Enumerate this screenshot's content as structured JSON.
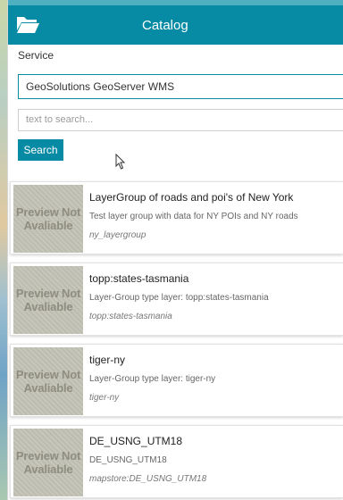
{
  "header": {
    "title": "Catalog",
    "icon": "folder-open-icon",
    "background_color": "#078aa3"
  },
  "service": {
    "label": "Service",
    "selected": "GeoSolutions GeoServer WMS"
  },
  "search": {
    "placeholder": "text to search...",
    "button_label": "Search"
  },
  "results": [
    {
      "thumbnail_text": "Preview Not Avaliable",
      "title": "LayerGroup of roads and poi's of New York",
      "description": "Test layer group with data for NY POIs and NY roads",
      "name": "ny_layergroup"
    },
    {
      "thumbnail_text": "Preview Not Avaliable",
      "title": "topp:states-tasmania",
      "description": "Layer-Group type layer: topp:states-tasmania",
      "name": "topp:states-tasmania"
    },
    {
      "thumbnail_text": "Preview Not Avaliable",
      "title": "tiger-ny",
      "description": "Layer-Group type layer: tiger-ny",
      "name": "tiger-ny"
    },
    {
      "thumbnail_text": "Preview Not Avaliable",
      "title": "DE_USNG_UTM18",
      "description": "DE_USNG_UTM18",
      "name": "mapstore:DE_USNG_UTM18"
    }
  ]
}
